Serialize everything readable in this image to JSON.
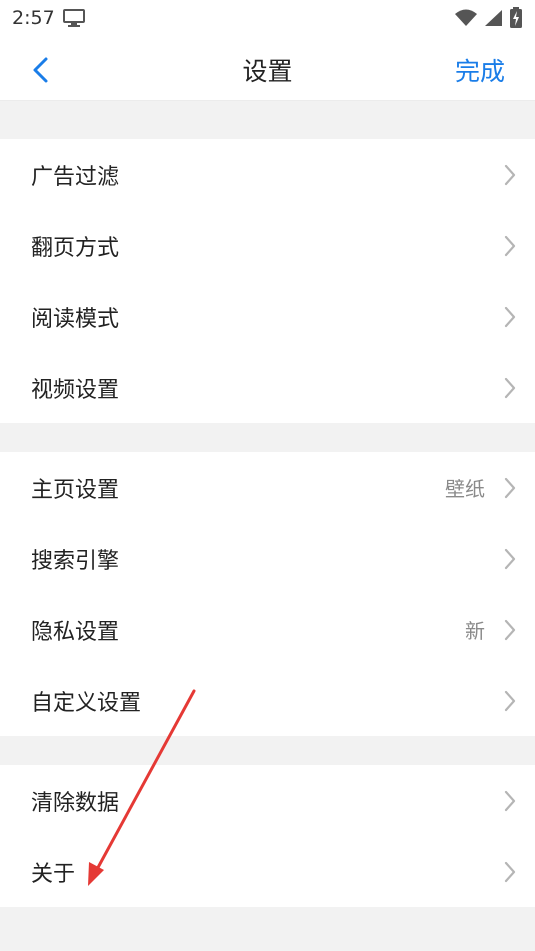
{
  "status_bar": {
    "time": "2:57",
    "icons": [
      "monitor-icon",
      "wifi-icon",
      "signal-icon",
      "battery-charging-icon"
    ]
  },
  "nav": {
    "back_icon": "chevron-left-icon",
    "title": "设置",
    "done_label": "完成"
  },
  "groups": [
    {
      "items": [
        {
          "label": "广告过滤",
          "value": ""
        },
        {
          "label": "翻页方式",
          "value": ""
        },
        {
          "label": "阅读模式",
          "value": ""
        },
        {
          "label": "视频设置",
          "value": ""
        }
      ]
    },
    {
      "items": [
        {
          "label": "主页设置",
          "value": "壁纸"
        },
        {
          "label": "搜索引擎",
          "value": ""
        },
        {
          "label": "隐私设置",
          "value": "新"
        },
        {
          "label": "自定义设置",
          "value": ""
        }
      ]
    },
    {
      "items": [
        {
          "label": "清除数据",
          "value": ""
        },
        {
          "label": "关于",
          "value": ""
        }
      ]
    }
  ],
  "colors": {
    "accent": "#1a7de8",
    "annotation_arrow": "#e53935",
    "background": "#f2f2f2"
  }
}
